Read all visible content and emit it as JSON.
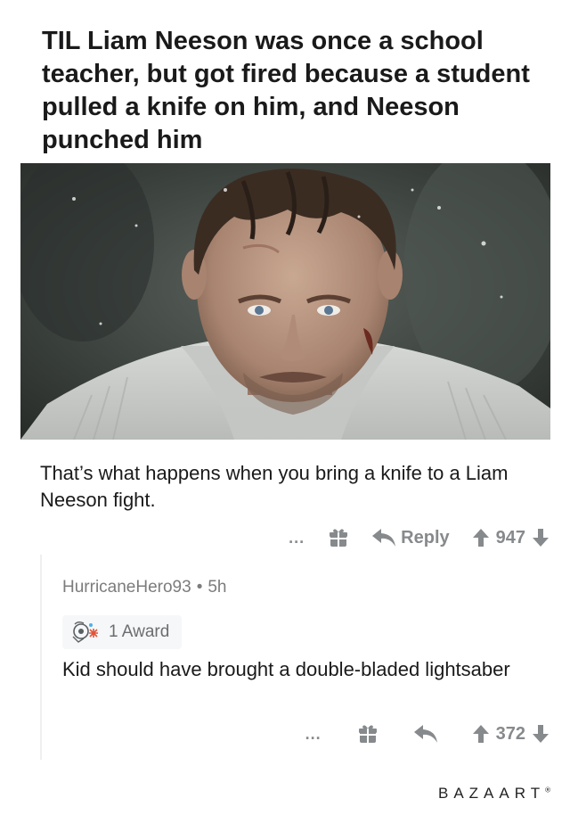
{
  "post": {
    "title": "TIL Liam Neeson was once a school teacher, but got fired because a student pulled a knife on him, and Neeson punched him"
  },
  "comment": {
    "body": "That’s what happens when you bring a knife to a Liam Neeson fight.",
    "more": "...",
    "reply_label": "Reply",
    "votes": "947"
  },
  "reply": {
    "username": "HurricaneHero93",
    "separator": "•",
    "age": "5h",
    "award": "1 Award",
    "body": "Kid should have brought a double-bladed lightsaber",
    "more": "...",
    "votes": "372"
  },
  "watermark": {
    "text": "BAZAART",
    "mark": "®"
  },
  "colors": {
    "text": "#1a1a1b",
    "muted": "#878a8c",
    "thread": "#edeff1"
  }
}
